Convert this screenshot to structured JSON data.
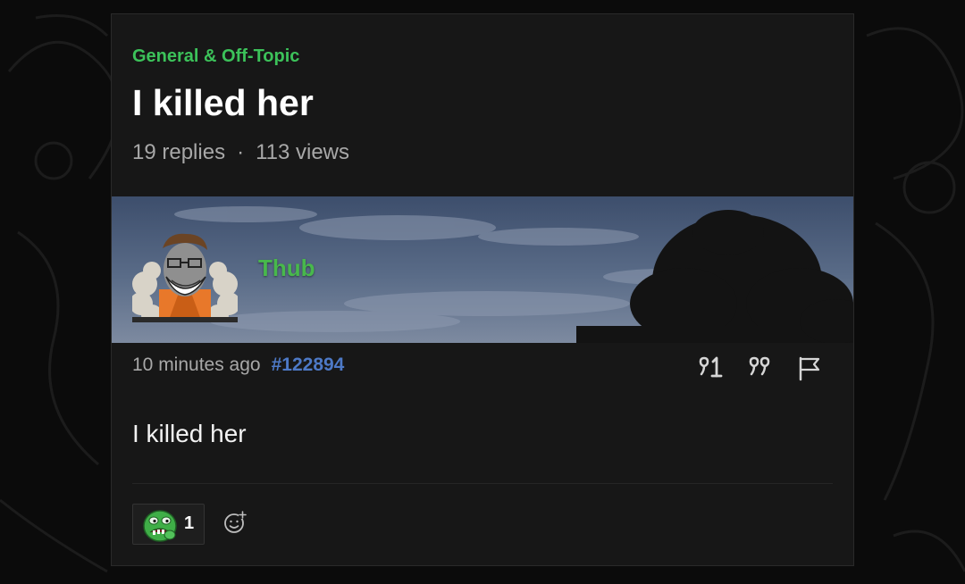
{
  "topic": {
    "category": "General & Off-Topic",
    "title": "I killed her",
    "replies": "19 replies",
    "separator": "·",
    "views": "113 views"
  },
  "post": {
    "username": "Thub",
    "time": "10 minutes ago",
    "post_number": "#122894",
    "body": "I killed her",
    "actions": {
      "quote_icon": "quote-reply-icon",
      "quote_count_icon": "quote-icon",
      "flag_icon": "flag-icon"
    },
    "reactions": [
      {
        "icon": "green-frog-face-icon",
        "count": "1"
      }
    ],
    "add_reaction_icon": "add-reaction-icon"
  },
  "colors": {
    "category": "#3cc25a",
    "username": "#48b84c",
    "post_number": "#4d79c6",
    "card_bg": "#171717",
    "page_bg": "#0b0b0b"
  }
}
